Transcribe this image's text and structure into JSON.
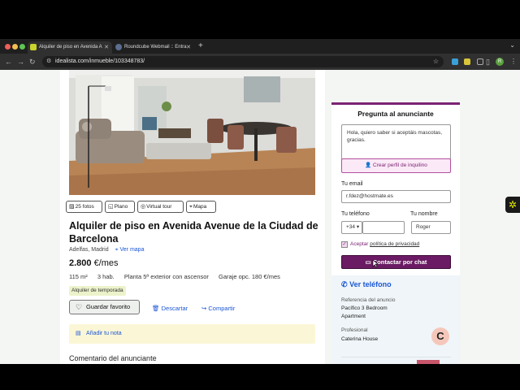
{
  "browser": {
    "tabs": [
      {
        "title": "Alquiler de piso en Avenida A",
        "favicon_color": "#c9d32b",
        "active": true
      },
      {
        "title": "Roundcube Webmail :: Entra",
        "favicon_color": "#5b6e8f",
        "active": false
      }
    ],
    "url": "idealista.com/inmueble/103348783/"
  },
  "gallery": {
    "chips": [
      {
        "icon": "image-icon",
        "label": "25 fotos"
      },
      {
        "icon": "floorplan-icon",
        "label": "Plano"
      },
      {
        "icon": "360-icon",
        "label": "Virtual tour"
      },
      {
        "icon": "map-pin-icon",
        "label": "Mapa"
      }
    ]
  },
  "listing": {
    "title": "Alquiler de piso en Avenida Avenue de la Ciudad de Barcelona",
    "location": "Adelfas, Madrid",
    "map_link": "Ver mapa",
    "price": "2.800",
    "price_unit": "€/mes",
    "features": [
      "115 m²",
      "3 hab.",
      "Planta 5ª exterior con ascensor",
      "Garaje opc. 180 €/mes"
    ],
    "badge": "Alquiler de temporada",
    "fav_button": "Guardar favorito",
    "discard": "Descartar",
    "share": "Compartir",
    "note": "Añadir tu nota",
    "comment_heading": "Comentario del anunciante"
  },
  "contact": {
    "title": "Pregunta al anunciante",
    "message": "Hola, quiero saber si  aceptáis mascotas, gracias.",
    "create_profile": "Crear perfil de inquilino",
    "email_label": "Tu email",
    "email_value": "r.fdez@hostmate.es",
    "phone_label": "Tu teléfono",
    "phone_prefix": "+34",
    "name_label": "Tu nombre",
    "name_value": "Roger",
    "accept_text": "Aceptar",
    "privacy_link": "política de privacidad",
    "chat_button": "Contactar por chat",
    "accent_color": "#7b2374"
  },
  "advertiser": {
    "phone_link": "Ver teléfono",
    "ref_label": "Referencia del anuncio",
    "ref_value": "Pacífico 3 Bedroom Apartment",
    "pro_label": "Profesional",
    "pro_value": "Caterina House",
    "avatar_letter": "C"
  }
}
